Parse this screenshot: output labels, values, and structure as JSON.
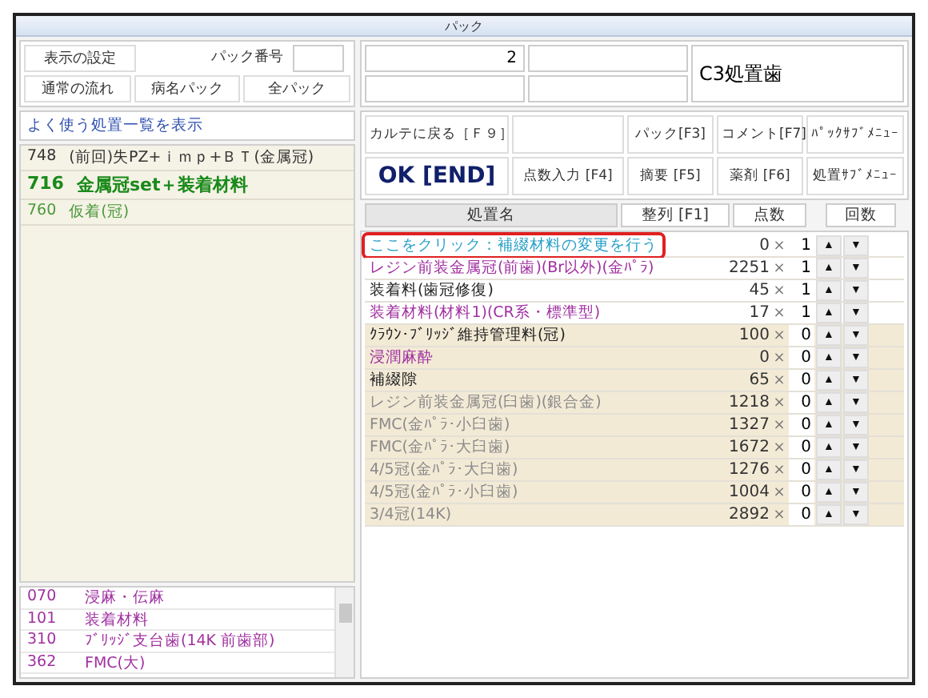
{
  "window": {
    "title": "パック"
  },
  "settings": {
    "display_button": "表示の設定",
    "pack_number_label": "パック番号",
    "flow_buttons": [
      "通常の流れ",
      "病名パック",
      "全パック"
    ]
  },
  "header_fields": {
    "field_1": "2",
    "tooth": "C3処置歯"
  },
  "frequent": {
    "link": "よく使う処置一覧を表示",
    "items": [
      {
        "code": "748",
        "name": "(前回)失PZ+ｉｍｐ+ＢＴ(金属冠)",
        "color": "#333333",
        "emphasized": false
      },
      {
        "code": "716",
        "name": "金属冠set＋装着材料",
        "color": "#1a8a1a",
        "emphasized": true
      },
      {
        "code": "760",
        "name": "仮着(冠)",
        "color": "#4a9a3a",
        "emphasized": false
      }
    ]
  },
  "category_list": [
    {
      "code": "070",
      "name": "浸麻・伝麻"
    },
    {
      "code": "101",
      "name": "装着材料"
    },
    {
      "code": "310",
      "name": "ﾌﾞﾘｯｼﾞ支台歯(14K 前歯部)"
    },
    {
      "code": "362",
      "name": "FMC(大)"
    }
  ],
  "actions": {
    "row_1": [
      "カルテに戻る［Ｆ９］",
      "パック[F3]",
      "コメント[F7]",
      "ﾊﾟｯｸｻﾌﾞﾒﾆｭｰ"
    ],
    "ok": "OK [END]",
    "row_2": [
      "点数入力 [F4]",
      "摘要 [F5]",
      "薬剤 [F6]",
      "処置ｻﾌﾞﾒﾆｭｰ"
    ]
  },
  "table": {
    "columns": [
      "処置名",
      "整列 [F1]",
      "点数",
      "回数"
    ],
    "rows": [
      {
        "name": "ここをクリック：補綴材料の変更を行う",
        "points": "0",
        "times_sign": "×",
        "count": "1",
        "color": "#2aa0c8",
        "included": true,
        "highlighted": true
      },
      {
        "name": "レジン前装金属冠(前歯)(Br以外)(金ﾊﾟﾗ)",
        "points": "2251",
        "times_sign": "×",
        "count": "1",
        "color": "#a030a0",
        "included": true,
        "highlighted": false
      },
      {
        "name": "装着料(歯冠修復)",
        "points": "45",
        "times_sign": "×",
        "count": "1",
        "color": "#222222",
        "included": true,
        "highlighted": false
      },
      {
        "name": "装着材料(材料1)(CR系・標準型)",
        "points": "17",
        "times_sign": "×",
        "count": "1",
        "color": "#a030a0",
        "included": true,
        "highlighted": false
      },
      {
        "name": "ｸﾗｳﾝ･ﾌﾞﾘｯｼﾞ維持管理料(冠)",
        "points": "100",
        "times_sign": "×",
        "count": "0",
        "color": "#222222",
        "included": false,
        "highlighted": false
      },
      {
        "name": "浸潤麻酔",
        "points": "0",
        "times_sign": "×",
        "count": "0",
        "color": "#a030a0",
        "included": false,
        "highlighted": false
      },
      {
        "name": "補綴隙",
        "points": "65",
        "times_sign": "×",
        "count": "0",
        "color": "#222222",
        "included": false,
        "highlighted": false
      },
      {
        "name": "レジン前装金属冠(臼歯)(銀合金)",
        "points": "1218",
        "times_sign": "×",
        "count": "0",
        "color": "#8a8a8a",
        "included": false,
        "highlighted": false
      },
      {
        "name": "FMC(金ﾊﾟﾗ･小臼歯)",
        "points": "1327",
        "times_sign": "×",
        "count": "0",
        "color": "#8a8a8a",
        "included": false,
        "highlighted": false
      },
      {
        "name": "FMC(金ﾊﾟﾗ･大臼歯)",
        "points": "1672",
        "times_sign": "×",
        "count": "0",
        "color": "#8a8a8a",
        "included": false,
        "highlighted": false
      },
      {
        "name": "4/5冠(金ﾊﾟﾗ･大臼歯)",
        "points": "1276",
        "times_sign": "×",
        "count": "0",
        "color": "#8a8a8a",
        "included": false,
        "highlighted": false
      },
      {
        "name": "4/5冠(金ﾊﾟﾗ･小臼歯)",
        "points": "1004",
        "times_sign": "×",
        "count": "0",
        "color": "#8a8a8a",
        "included": false,
        "highlighted": false
      },
      {
        "name": "3/4冠(14K)",
        "points": "2892",
        "times_sign": "×",
        "count": "0",
        "color": "#8a8a8a",
        "included": false,
        "highlighted": false
      }
    ]
  },
  "stepper": {
    "up": "▲",
    "down": "▼"
  }
}
